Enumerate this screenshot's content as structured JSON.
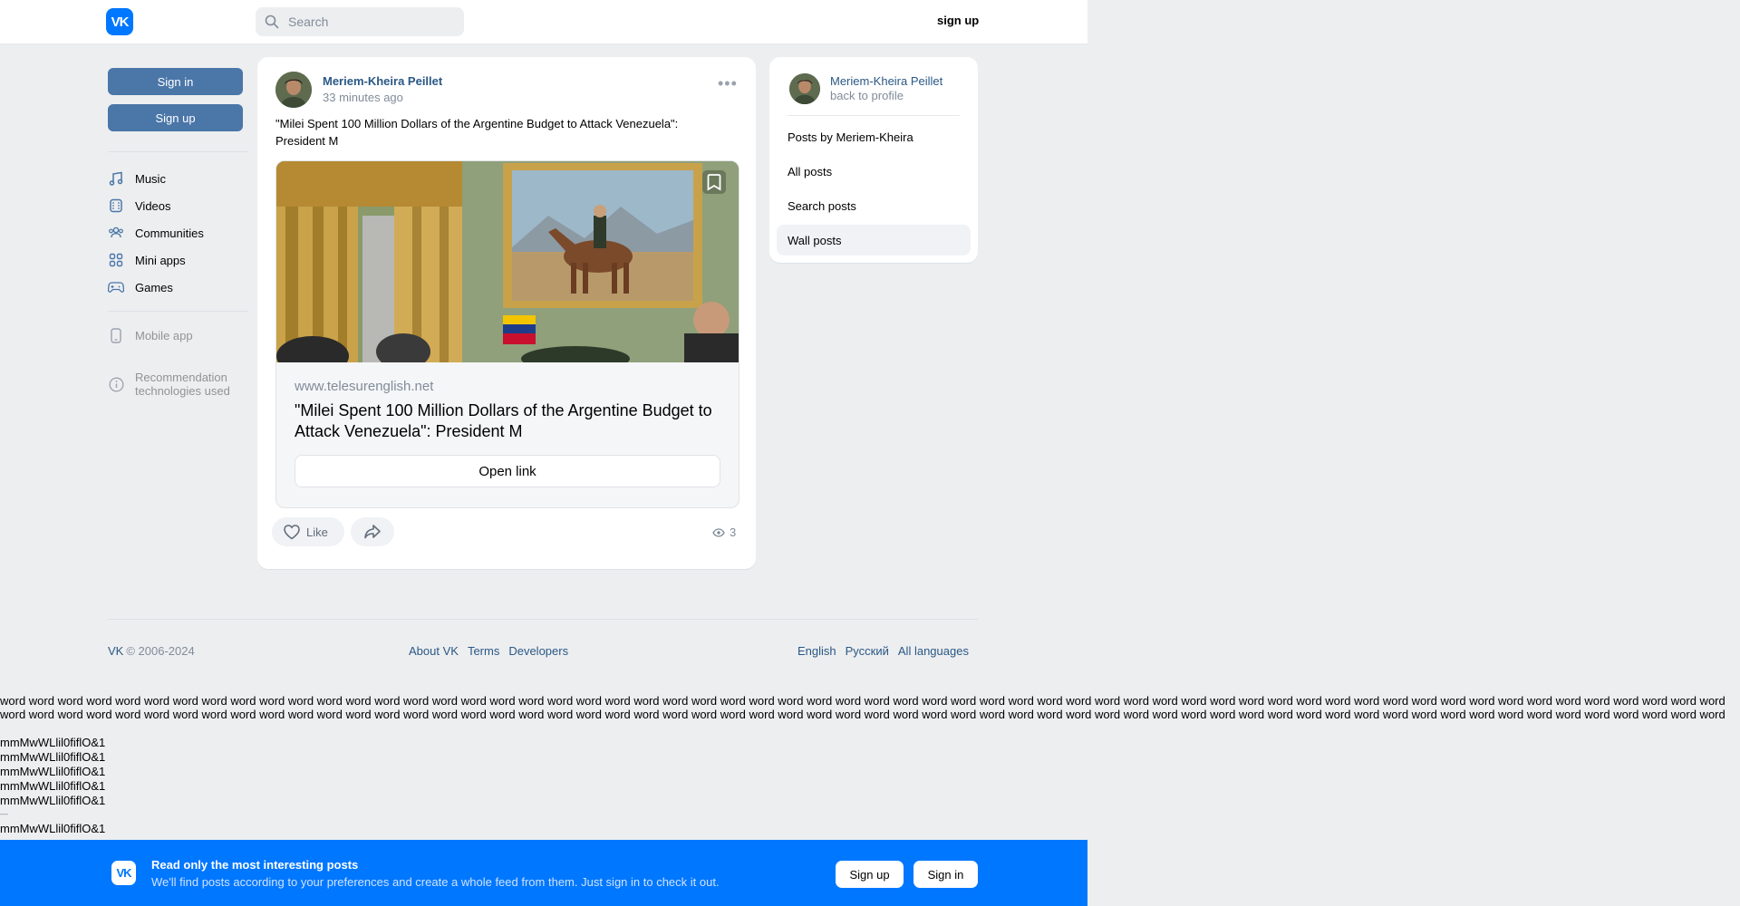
{
  "header": {
    "logo_text": "VK",
    "search_placeholder": "Search",
    "signup_label": "sign up"
  },
  "left": {
    "signin_label": "Sign in",
    "signup_label": "Sign up",
    "nav": [
      {
        "label": "Music",
        "icon": "music-icon"
      },
      {
        "label": "Videos",
        "icon": "videos-icon"
      },
      {
        "label": "Communities",
        "icon": "communities-icon"
      },
      {
        "label": "Mini apps",
        "icon": "mini-apps-icon"
      },
      {
        "label": "Games",
        "icon": "games-icon"
      }
    ],
    "mobile_app": "Mobile app",
    "recommendation_line1": "Recommendation",
    "recommendation_line2": "technologies used"
  },
  "post": {
    "author": "Meriem-Kheira Peillet",
    "time": "33 minutes ago",
    "text": "\"Milei Spent 100 Million Dollars of the Argentine Budget to Attack Venezuela\": President M",
    "link": {
      "domain": "www.telesurenglish.net",
      "title": "\"Milei Spent 100 Million Dollars of the Argentine Budget to Attack Venezuela\": President M",
      "open_label": "Open link"
    },
    "like_label": "Like",
    "views": "3"
  },
  "side": {
    "name": "Meriem-Kheira Peillet",
    "back": "back to profile",
    "items": [
      {
        "label": "Posts by Meriem-Kheira"
      },
      {
        "label": "All posts"
      },
      {
        "label": "Search posts"
      },
      {
        "label": "Wall posts"
      }
    ]
  },
  "footer": {
    "brand": "VK",
    "copyright": "© 2006-2024",
    "links": [
      "About VK",
      "Terms",
      "Developers"
    ],
    "languages": [
      "English",
      "Русский",
      "All languages"
    ]
  },
  "debug": {
    "words": "word word word word word word word word word word word word word word word word word word word word word word word word word word word word word word word word word word word word word word word word word word word word word word word word word word word word word word word word word word word word",
    "mm": "mmMwWLlil0fiflO&1",
    "dash": "—"
  },
  "promo": {
    "logo_text": "VK",
    "title": "Read only the most interesting posts",
    "subtitle": "We'll find posts according to your preferences and create a whole feed from them. Just sign in to check it out.",
    "signup_label": "Sign up",
    "signin_label": "Sign in"
  },
  "colors": {
    "accent": "#0077ff",
    "button": "#4a76a8",
    "link": "#2a5885",
    "background": "#edeef0"
  }
}
